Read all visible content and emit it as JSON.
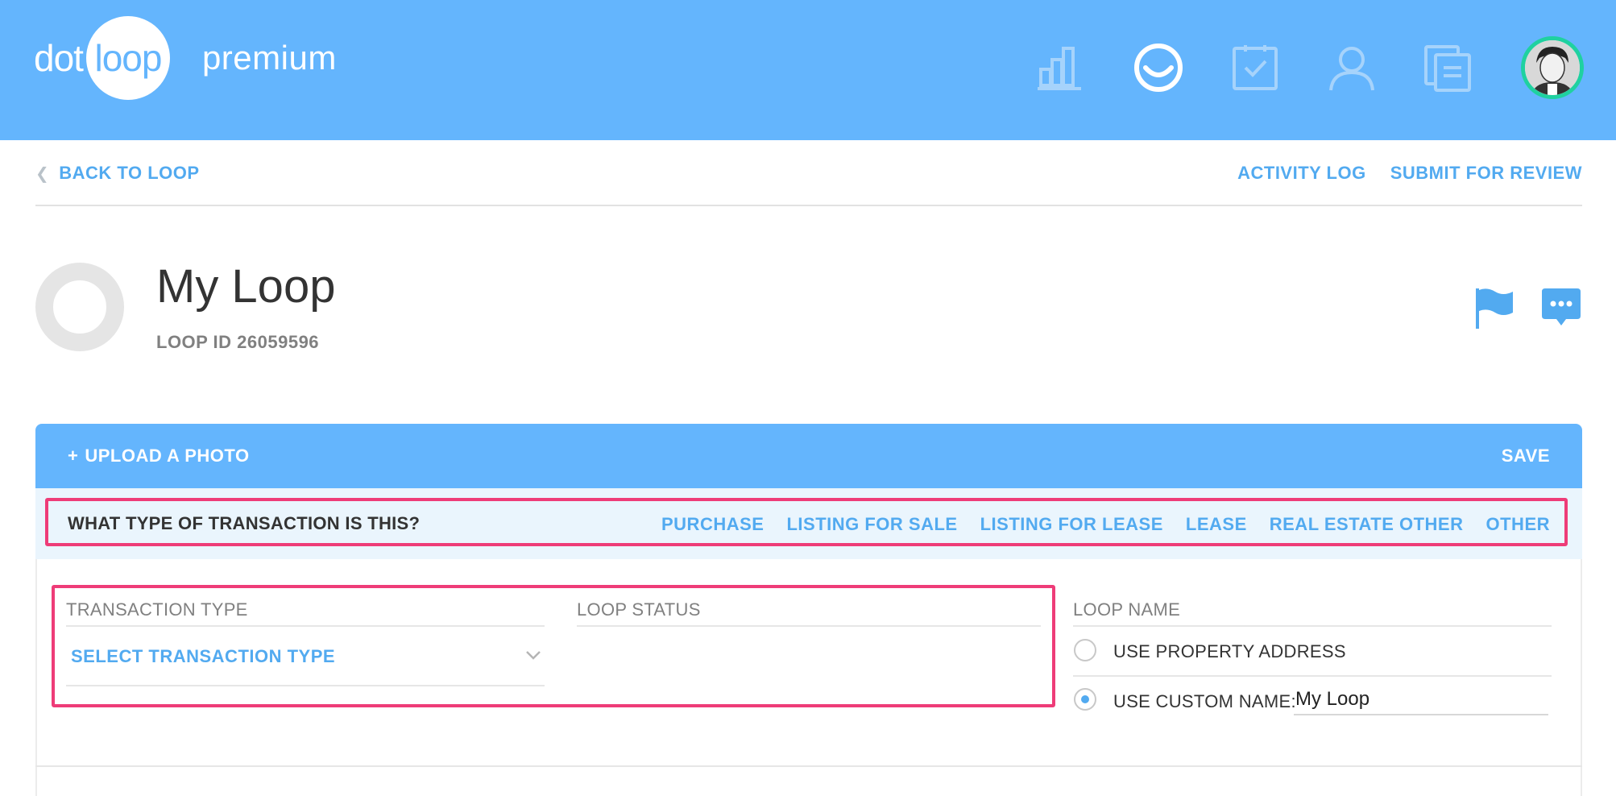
{
  "header": {
    "logo_left": "dot",
    "logo_circle": "loop",
    "logo_suffix": "premium",
    "nav_icons": [
      "bar-chart-icon",
      "loop-smile-icon",
      "task-check-icon",
      "person-icon",
      "documents-icon"
    ],
    "colors": {
      "brand": "#64b5fd",
      "accent": "#52aaf0",
      "highlight": "#ee3c78",
      "avatar_ring": "#1fd1a0"
    }
  },
  "subnav": {
    "back": "BACK TO LOOP",
    "activity_log": "ACTIVITY LOG",
    "submit": "SUBMIT FOR REVIEW"
  },
  "loop": {
    "title": "My Loop",
    "id_label": "LOOP ID 26059596"
  },
  "panel": {
    "upload": "UPLOAD A PHOTO",
    "save": "SAVE"
  },
  "transaction": {
    "question": "WHAT TYPE OF TRANSACTION IS THIS?",
    "options": [
      "PURCHASE",
      "LISTING FOR SALE",
      "LISTING FOR LEASE",
      "LEASE",
      "REAL ESTATE OTHER",
      "OTHER"
    ]
  },
  "fields": {
    "transaction_type_label": "TRANSACTION TYPE",
    "transaction_type_placeholder": "SELECT TRANSACTION TYPE",
    "loop_status_label": "LOOP STATUS",
    "loop_name_label": "LOOP NAME",
    "use_property_address": "USE PROPERTY ADDRESS",
    "use_custom_name": "USE CUSTOM NAME:",
    "custom_name_value": "My Loop"
  }
}
